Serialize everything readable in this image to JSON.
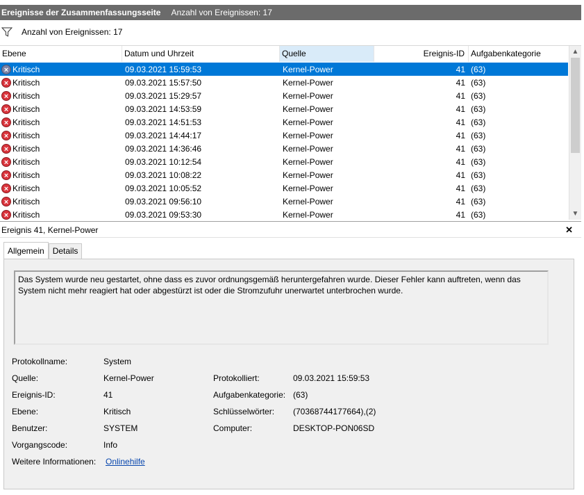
{
  "title": {
    "main": "Ereignisse der Zusammenfassungsseite",
    "count": "Anzahl von Ereignissen: 17"
  },
  "filter_bar": {
    "label": "Anzahl von Ereignissen: 17"
  },
  "columns": [
    "Ebene",
    "Datum und Uhrzeit",
    "Quelle",
    "Ereignis-ID",
    "Aufgabenkategorie"
  ],
  "rows": [
    {
      "level": "Kritisch",
      "date": "09.03.2021 15:59:53",
      "source": "Kernel-Power",
      "id": "41",
      "cat": "(63)"
    },
    {
      "level": "Kritisch",
      "date": "09.03.2021 15:57:50",
      "source": "Kernel-Power",
      "id": "41",
      "cat": "(63)"
    },
    {
      "level": "Kritisch",
      "date": "09.03.2021 15:29:57",
      "source": "Kernel-Power",
      "id": "41",
      "cat": "(63)"
    },
    {
      "level": "Kritisch",
      "date": "09.03.2021 14:53:59",
      "source": "Kernel-Power",
      "id": "41",
      "cat": "(63)"
    },
    {
      "level": "Kritisch",
      "date": "09.03.2021 14:51:53",
      "source": "Kernel-Power",
      "id": "41",
      "cat": "(63)"
    },
    {
      "level": "Kritisch",
      "date": "09.03.2021 14:44:17",
      "source": "Kernel-Power",
      "id": "41",
      "cat": "(63)"
    },
    {
      "level": "Kritisch",
      "date": "09.03.2021 14:36:46",
      "source": "Kernel-Power",
      "id": "41",
      "cat": "(63)"
    },
    {
      "level": "Kritisch",
      "date": "09.03.2021 10:12:54",
      "source": "Kernel-Power",
      "id": "41",
      "cat": "(63)"
    },
    {
      "level": "Kritisch",
      "date": "09.03.2021 10:08:22",
      "source": "Kernel-Power",
      "id": "41",
      "cat": "(63)"
    },
    {
      "level": "Kritisch",
      "date": "09.03.2021 10:05:52",
      "source": "Kernel-Power",
      "id": "41",
      "cat": "(63)"
    },
    {
      "level": "Kritisch",
      "date": "09.03.2021 09:56:10",
      "source": "Kernel-Power",
      "id": "41",
      "cat": "(63)"
    },
    {
      "level": "Kritisch",
      "date": "09.03.2021 09:53:30",
      "source": "Kernel-Power",
      "id": "41",
      "cat": "(63)"
    }
  ],
  "detail": {
    "header": "Ereignis 41, Kernel-Power",
    "tabs": [
      "Allgemein",
      "Details"
    ],
    "description": "Das System wurde neu gestartet, ohne dass es zuvor ordnungsgemäß heruntergefahren wurde. Dieser Fehler kann auftreten, wenn das System nicht mehr reagiert hat oder abgestürzt ist oder die Stromzufuhr unerwartet unterbrochen wurde.",
    "props": {
      "protokollname_label": "Protokollname:",
      "protokollname": "System",
      "quelle_label": "Quelle:",
      "quelle": "Kernel-Power",
      "protokolliert_label": "Protokolliert:",
      "protokolliert": "09.03.2021 15:59:53",
      "ereignisid_label": "Ereignis-ID:",
      "ereignisid": "41",
      "aufgabe_label": "Aufgabenkategorie:",
      "aufgabe": "(63)",
      "ebene_label": "Ebene:",
      "ebene": "Kritisch",
      "schluessel_label": "Schlüsselwörter:",
      "schluessel": "(70368744177664),(2)",
      "benutzer_label": "Benutzer:",
      "benutzer": "SYSTEM",
      "computer_label": "Computer:",
      "computer": "DESKTOP-PON06SD",
      "vorgang_label": "Vorgangscode:",
      "vorgang": "Info",
      "weitere_label": "Weitere Informationen:",
      "weitere": "Onlinehilfe"
    }
  },
  "colors": {
    "selected_row": "#0078d7",
    "title_bar": "#6b6b6b",
    "error_icon": "#d9343c",
    "link": "#0645ad"
  }
}
